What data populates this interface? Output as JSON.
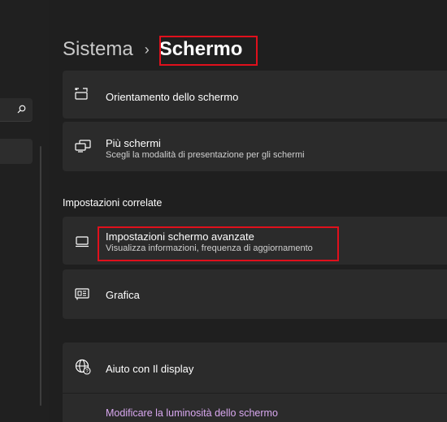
{
  "breadcrumb": {
    "parent": "Sistema",
    "separator": "›",
    "current": "Schermo"
  },
  "cards": {
    "orientation": {
      "title": "Orientamento dello schermo",
      "icon": "screen-rotation-icon"
    },
    "multiple_displays": {
      "title": "Più schermi",
      "subtitle": "Scegli la modalità di presentazione per gli schermi",
      "icon": "multiple-displays-icon"
    }
  },
  "related_section": {
    "title": "Impostazioni correlate",
    "advanced_display": {
      "title": "Impostazioni schermo avanzate",
      "subtitle": "Visualizza informazioni, frequenza di aggiornamento",
      "icon": "monitor-icon"
    },
    "graphics": {
      "title": "Grafica",
      "icon": "graphics-card-icon"
    }
  },
  "help": {
    "title": "Aiuto con Il display",
    "link": "Modificare la luminosità dello schermo",
    "icon": "globe-help-icon"
  },
  "colors": {
    "highlight": "#e0101c",
    "link": "#d9a8f0",
    "card": "#2b2b2b",
    "background": "#1f1f1f"
  }
}
